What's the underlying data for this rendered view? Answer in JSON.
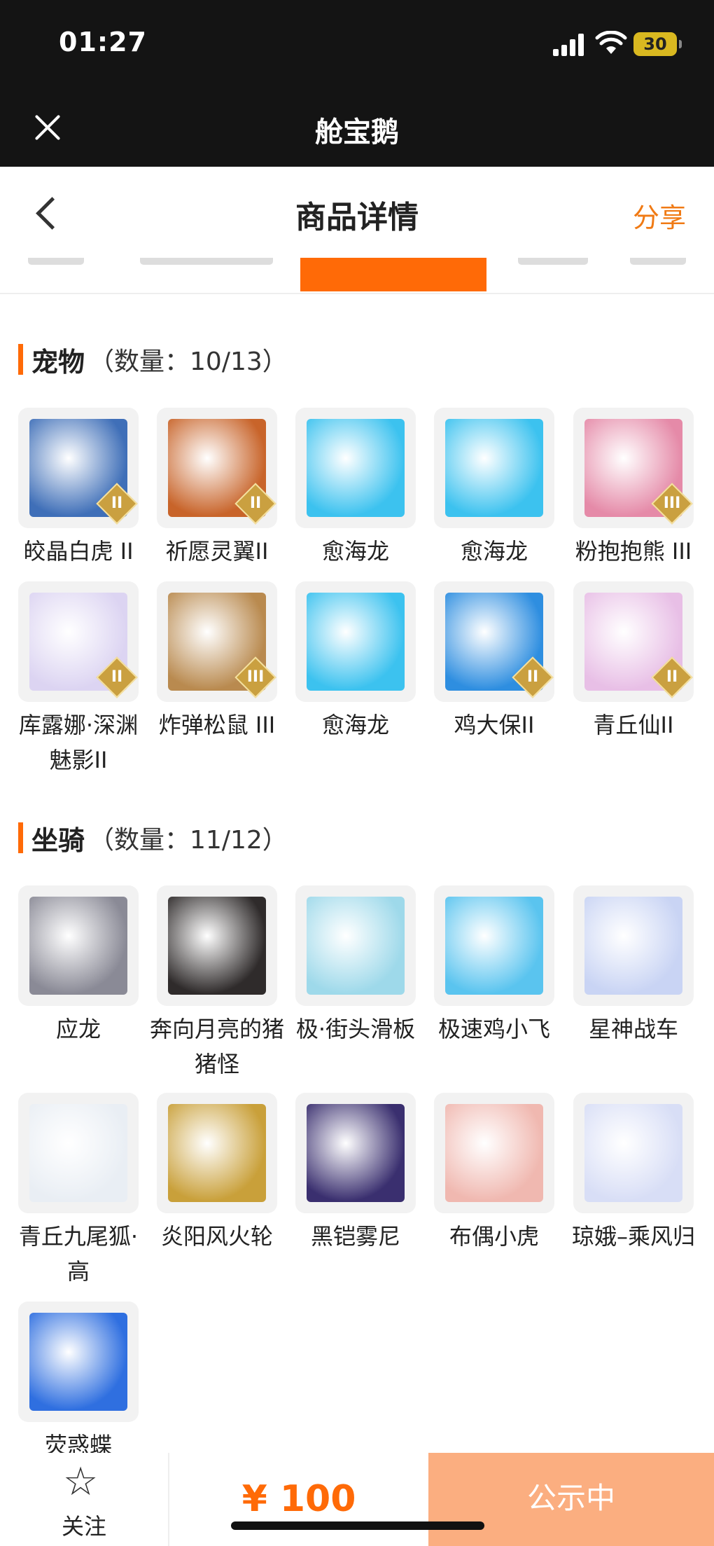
{
  "status_bar": {
    "time": "01:27",
    "battery": "30"
  },
  "app_bar": {
    "title": "舱宝鹅"
  },
  "header": {
    "title": "商品详情",
    "share_label": "分享"
  },
  "pets_section": {
    "title": "宠物",
    "count": "（数量：10/13）",
    "items": [
      {
        "name": "皎晶白虎 II",
        "badge": "II",
        "icon": "white-tiger-icon",
        "color": "#3f6fb8"
      },
      {
        "name": "祈愿灵翼II",
        "badge": "II",
        "icon": "phoenix-bird-icon",
        "color": "#c8642a"
      },
      {
        "name": "愈海龙",
        "badge": "",
        "icon": "sea-dragon-icon",
        "color": "#3cc2ef"
      },
      {
        "name": "愈海龙",
        "badge": "",
        "icon": "sea-dragon-icon",
        "color": "#3cc2ef"
      },
      {
        "name": "粉抱抱熊 III",
        "badge": "III",
        "icon": "pink-bear-icon",
        "color": "#e58aa8"
      },
      {
        "name": "库露娜·深渊魅影II",
        "badge": "II",
        "icon": "ghost-girl-icon",
        "color": "#dcd4f2"
      },
      {
        "name": "炸弹松鼠 III",
        "badge": "III",
        "icon": "squirrel-icon",
        "color": "#b98a4f"
      },
      {
        "name": "愈海龙",
        "badge": "",
        "icon": "sea-dragon-icon",
        "color": "#3cc2ef"
      },
      {
        "name": "鸡大保II",
        "badge": "II",
        "icon": "blue-chick-icon",
        "color": "#2e8ee0"
      },
      {
        "name": "青丘仙II",
        "badge": "II",
        "icon": "fox-fairy-icon",
        "color": "#e8bfe6"
      }
    ]
  },
  "mounts_section": {
    "title": "坐骑",
    "count": "（数量：11/12）",
    "items": [
      {
        "name": "应龙",
        "icon": "dragon-head-icon",
        "color": "#8a8a96"
      },
      {
        "name": "奔向月亮的猪猪怪",
        "icon": "pig-icon",
        "color": "#2f2b2b"
      },
      {
        "name": "极·街头滑板",
        "icon": "skateboard-icon",
        "color": "#9ed9ea"
      },
      {
        "name": "极速鸡小飞",
        "icon": "chick-icon",
        "color": "#5ac4ef"
      },
      {
        "name": "星神战车",
        "icon": "horse-icon",
        "color": "#c9d4f4"
      },
      {
        "name": "青丘九尾狐·高",
        "icon": "nine-tail-fox-icon",
        "color": "#e9eef4"
      },
      {
        "name": "炎阳风火轮",
        "icon": "fire-wheel-icon",
        "color": "#c9a03a"
      },
      {
        "name": "黑铠雾尼",
        "icon": "black-armor-beast-icon",
        "color": "#3a2f6f"
      },
      {
        "name": "布偶小虎",
        "icon": "toy-tiger-icon",
        "color": "#f0b8b0"
      },
      {
        "name": "琼娥–乘风归",
        "icon": "moon-fairy-icon",
        "color": "#d8def6"
      },
      {
        "name": "荧惑蝶",
        "icon": "butterfly-fish-icon",
        "color": "#2f6fe0"
      }
    ]
  },
  "bottom_bar": {
    "follow_label": "关注",
    "price": "¥ 100",
    "status_label": "公示中"
  }
}
